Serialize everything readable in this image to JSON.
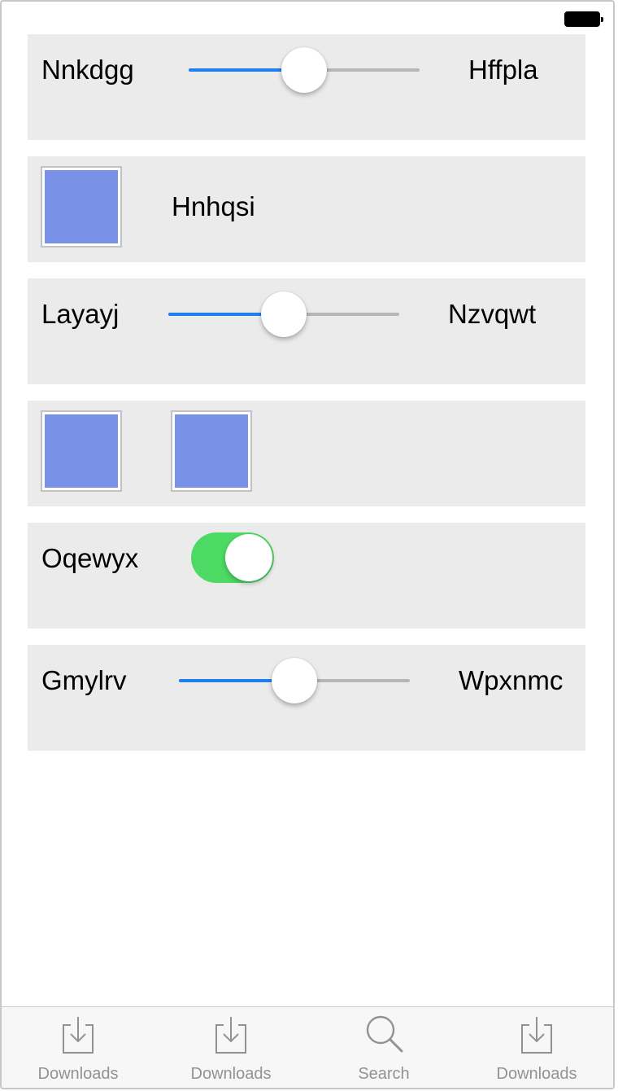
{
  "rows": {
    "row1": {
      "left_label": "Nnkdgg",
      "right_label": "Hffpla",
      "slider_value": 0.5
    },
    "row2": {
      "label": "Hnhqsi"
    },
    "row3": {
      "left_label": "Layayj",
      "right_label": "Nzvqwt",
      "slider_value": 0.5
    },
    "row5": {
      "label": "Oqewyx",
      "toggle_on": true
    },
    "row6": {
      "left_label": "Gmylrv",
      "right_label": "Wpxnmc",
      "slider_value": 0.5
    }
  },
  "colors": {
    "slider_fill": "#1f7ff0",
    "toggle_on": "#4cd964",
    "tile": "#7890e6",
    "row_background": "#ebebeb"
  },
  "tab_bar": {
    "tabs": [
      {
        "label": "Downloads",
        "icon": "download-icon"
      },
      {
        "label": "Downloads",
        "icon": "download-icon"
      },
      {
        "label": "Search",
        "icon": "search-icon"
      },
      {
        "label": "Downloads",
        "icon": "download-icon"
      }
    ]
  }
}
